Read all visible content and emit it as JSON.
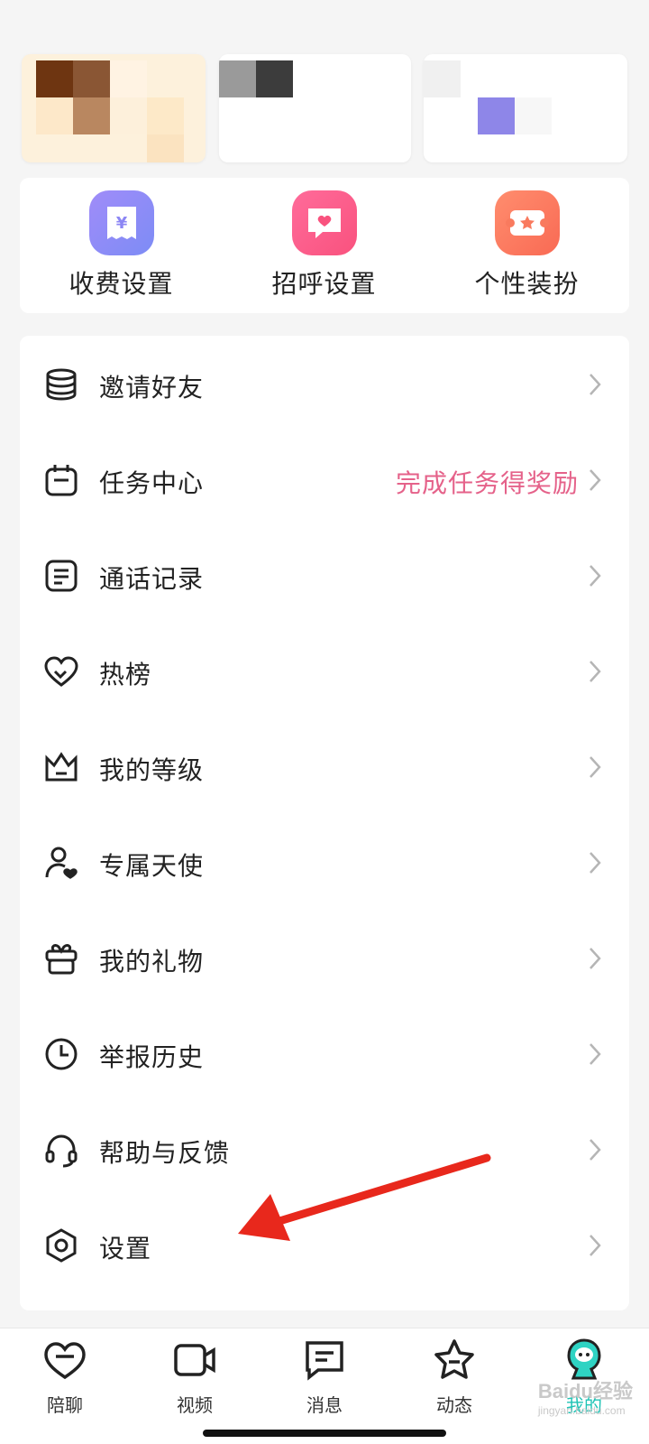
{
  "quick_actions": [
    {
      "label": "收费设置",
      "icon": "fee-settings-icon",
      "color": "#8e86f5"
    },
    {
      "label": "招呼设置",
      "icon": "greeting-settings-icon",
      "color": "#fb5f8c"
    },
    {
      "label": "个性装扮",
      "icon": "personal-dressup-icon",
      "color": "#fb7a5f"
    }
  ],
  "menu": [
    {
      "label": "邀请好友",
      "icon": "coins-icon",
      "extra": ""
    },
    {
      "label": "任务中心",
      "icon": "calendar-icon",
      "extra": "完成任务得奖励"
    },
    {
      "label": "通话记录",
      "icon": "document-icon",
      "extra": ""
    },
    {
      "label": "热榜",
      "icon": "heart-icon",
      "extra": ""
    },
    {
      "label": "我的等级",
      "icon": "crown-icon",
      "extra": ""
    },
    {
      "label": "专属天使",
      "icon": "user-heart-icon",
      "extra": ""
    },
    {
      "label": "我的礼物",
      "icon": "gift-icon",
      "extra": ""
    },
    {
      "label": "举报历史",
      "icon": "clock-icon",
      "extra": ""
    },
    {
      "label": "帮助与反馈",
      "icon": "headset-icon",
      "extra": ""
    },
    {
      "label": "设置",
      "icon": "settings-hexagon-icon",
      "extra": ""
    }
  ],
  "tabs": [
    {
      "label": "陪聊",
      "icon": "heart-chat-icon"
    },
    {
      "label": "视频",
      "icon": "video-camera-icon"
    },
    {
      "label": "消息",
      "icon": "message-icon"
    },
    {
      "label": "动态",
      "icon": "star-icon"
    },
    {
      "label": "我的",
      "icon": "profile-avatar-icon",
      "active": true
    }
  ],
  "colors": {
    "accent": "#20c3b5",
    "highlight_text": "#e5628a",
    "arrow": "#e8281c"
  },
  "watermark": {
    "brand": "Baidu经验",
    "url": "jingyan.baidu.com"
  }
}
